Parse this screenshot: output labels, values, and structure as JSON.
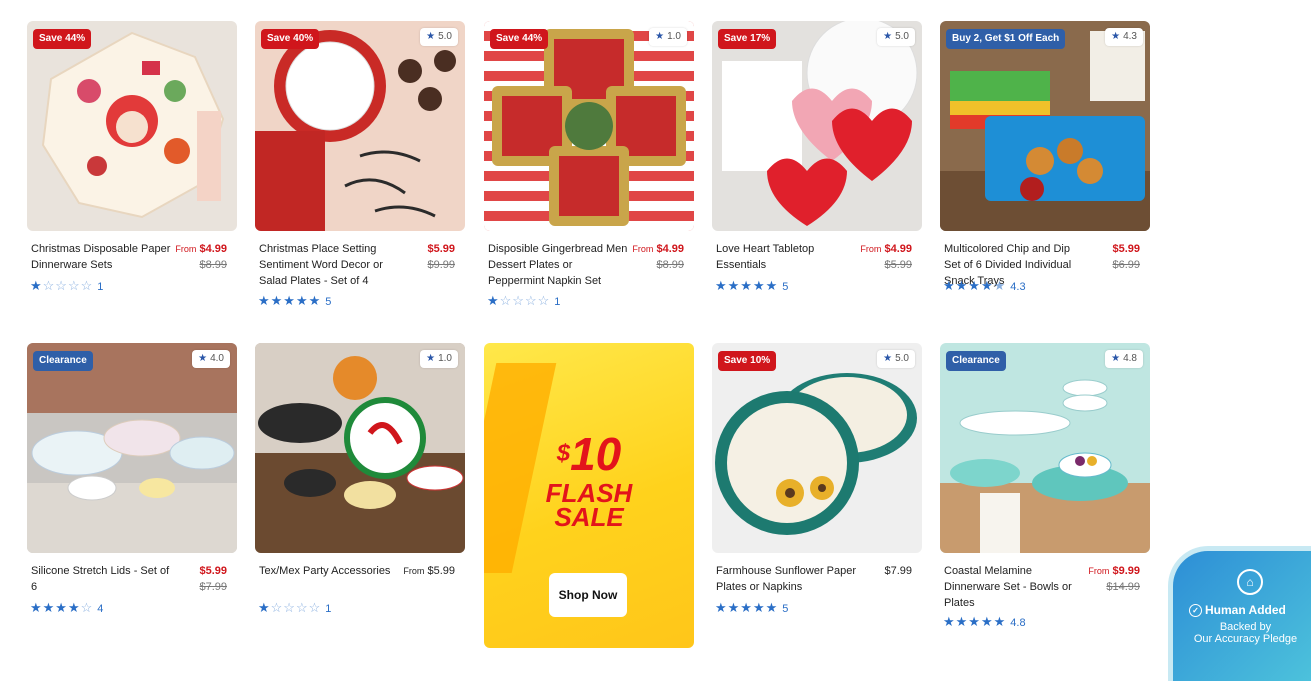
{
  "products": [
    {
      "badge": "Save 44%",
      "badge_color": "red",
      "rating_pill": "",
      "name": "Christmas Disposable Paper Dinnerware Sets",
      "from": "From",
      "price": "$4.99",
      "was": "$8.99",
      "stars_full": 1,
      "stars_empty": 4,
      "review_count": "1",
      "price_style": "sale"
    },
    {
      "badge": "Save 40%",
      "badge_color": "red",
      "rating_pill": "5.0",
      "name": "Christmas Place Setting Sentiment Word Decor or Salad Plates - Set of 4",
      "from": "",
      "price": "$5.99",
      "was": "$9.99",
      "stars_full": 5,
      "stars_empty": 0,
      "review_count": "5",
      "price_style": "sale"
    },
    {
      "badge": "Save 44%",
      "badge_color": "red",
      "rating_pill": "1.0",
      "name": "Disposible Gingerbread Men Dessert Plates or Peppermint Napkin Set",
      "from": "From",
      "price": "$4.99",
      "was": "$8.99",
      "stars_full": 1,
      "stars_empty": 4,
      "review_count": "1",
      "price_style": "sale"
    },
    {
      "badge": "Save 17%",
      "badge_color": "red",
      "rating_pill": "5.0",
      "name": "Love Heart Tabletop Essentials",
      "from": "From",
      "price": "$4.99",
      "was": "$5.99",
      "stars_full": 5,
      "stars_empty": 0,
      "review_count": "5",
      "price_style": "sale"
    },
    {
      "badge": "Buy 2, Get $1 Off Each",
      "badge_color": "blue",
      "rating_pill": "4.3",
      "name": "Multicolored Chip and Dip Set of 6 Divided Individual Snack Trays",
      "from": "",
      "price": "$5.99",
      "was": "$6.99",
      "stars_full": 4,
      "stars_empty": 1,
      "review_count": "4.3",
      "price_style": "sale"
    },
    {
      "badge": "Clearance",
      "badge_color": "blue",
      "rating_pill": "4.0",
      "name": "Silicone Stretch Lids - Set of 6",
      "from": "",
      "price": "$5.99",
      "was": "$7.99",
      "stars_full": 4,
      "stars_empty": 1,
      "review_count": "4",
      "price_style": "sale"
    },
    {
      "badge": "",
      "badge_color": "",
      "rating_pill": "1.0",
      "name": "Tex/Mex Party Accessories",
      "from": "From",
      "price": "$5.99",
      "was": "",
      "stars_full": 1,
      "stars_empty": 4,
      "review_count": "1",
      "price_style": "plain"
    },
    {
      "badge": "Save 10%",
      "badge_color": "red",
      "rating_pill": "5.0",
      "name": "Farmhouse Sunflower Paper Plates or Napkins",
      "from": "",
      "price": "$7.99",
      "was": "",
      "stars_full": 5,
      "stars_empty": 0,
      "review_count": "5",
      "price_style": "plain"
    },
    {
      "badge": "Clearance",
      "badge_color": "blue",
      "rating_pill": "4.8",
      "name": "Coastal Melamine Dinnerware Set - Bowls or Plates",
      "from": "From",
      "price": "$9.99",
      "was": "$14.99",
      "stars_full": 5,
      "stars_empty": 0,
      "review_count": "4.8",
      "price_style": "sale"
    }
  ],
  "flash_sale": {
    "currency": "$",
    "amount": "10",
    "line1": "FLASH",
    "line2": "SALE",
    "button": "Shop Now"
  },
  "pledge": {
    "title": "Human Added",
    "line1": "Backed by",
    "line2": "Our Accuracy Pledge"
  },
  "colors": {
    "sale_red": "#d0161c",
    "badge_blue": "#2f5fa8",
    "star_blue": "#2a6ec6",
    "flash_yellow": "#ffd21c"
  }
}
